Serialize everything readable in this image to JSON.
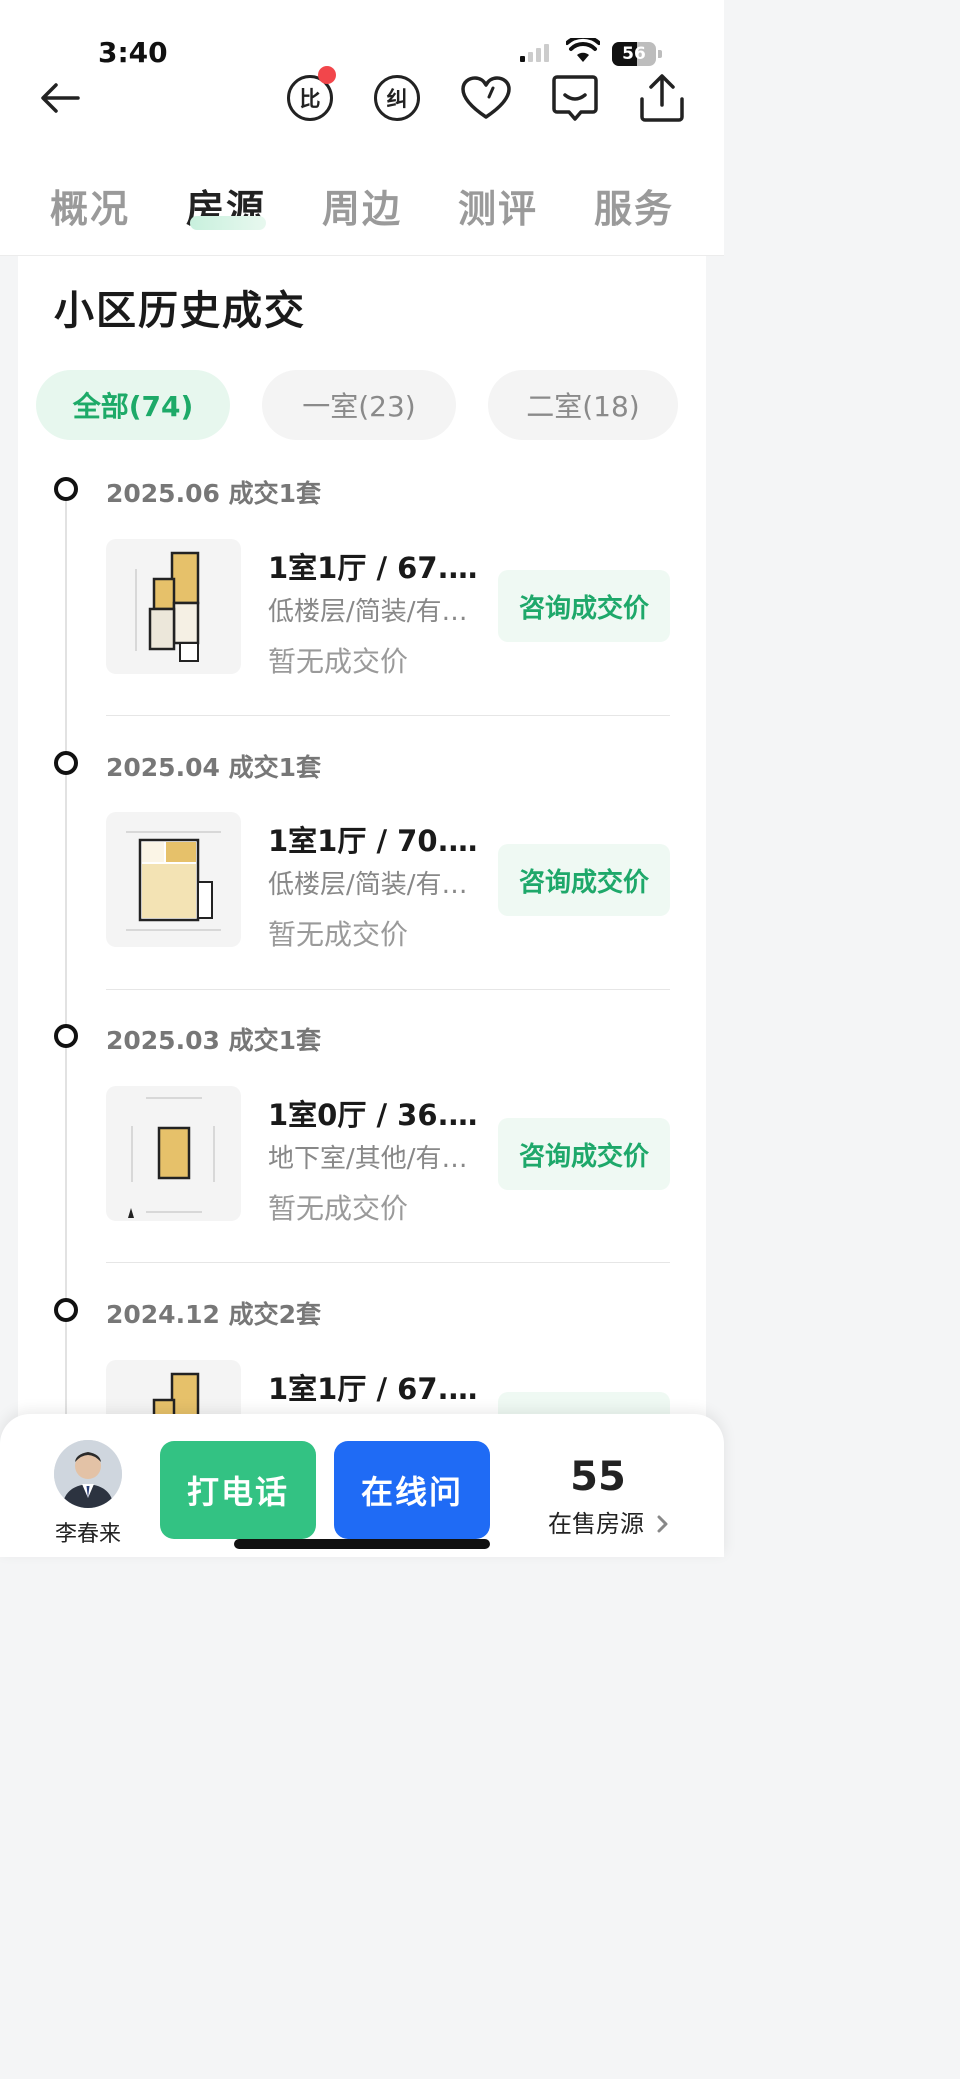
{
  "status": {
    "time": "3:40",
    "battery": "56"
  },
  "tabs": [
    {
      "label": "概况",
      "active": false
    },
    {
      "label": "房源",
      "active": true
    },
    {
      "label": "周边",
      "active": false
    },
    {
      "label": "测评",
      "active": false
    },
    {
      "label": "服务",
      "active": false
    }
  ],
  "toolbar": {
    "compare_label": "比",
    "correct_label": "纠"
  },
  "section": {
    "title": "小区历史成交"
  },
  "filters": [
    {
      "label": "全部(74)",
      "active": true
    },
    {
      "label": "一室(23)",
      "active": false
    },
    {
      "label": "二室(18)",
      "active": false
    }
  ],
  "records": [
    {
      "period": "2025.06 成交1套",
      "title": "1室1厅 / 67.…",
      "tags": "低楼层/简装/有…",
      "price": "暂无成交价",
      "button": "咨询成交价"
    },
    {
      "period": "2025.04 成交1套",
      "title": "1室1厅 / 70.…",
      "tags": "低楼层/简装/有…",
      "price": "暂无成交价",
      "button": "咨询成交价"
    },
    {
      "period": "2025.03 成交1套",
      "title": "1室0厅 / 36.…",
      "tags": "地下室/其他/有…",
      "price": "暂无成交价",
      "button": "咨询成交价"
    },
    {
      "period": "2024.12 成交2套",
      "title": "1室1厅 / 67.…",
      "tags": "",
      "price": "",
      "button": ""
    }
  ],
  "bottom_bar": {
    "agent_name": "李春来",
    "call_label": "打电话",
    "chat_label": "在线问",
    "listings_count": "55",
    "listings_label": "在售房源"
  },
  "colors": {
    "accent_green": "#1ea86a",
    "call_green": "#33c283",
    "chat_blue": "#1f6bf5",
    "badge_red": "#f2464b"
  }
}
